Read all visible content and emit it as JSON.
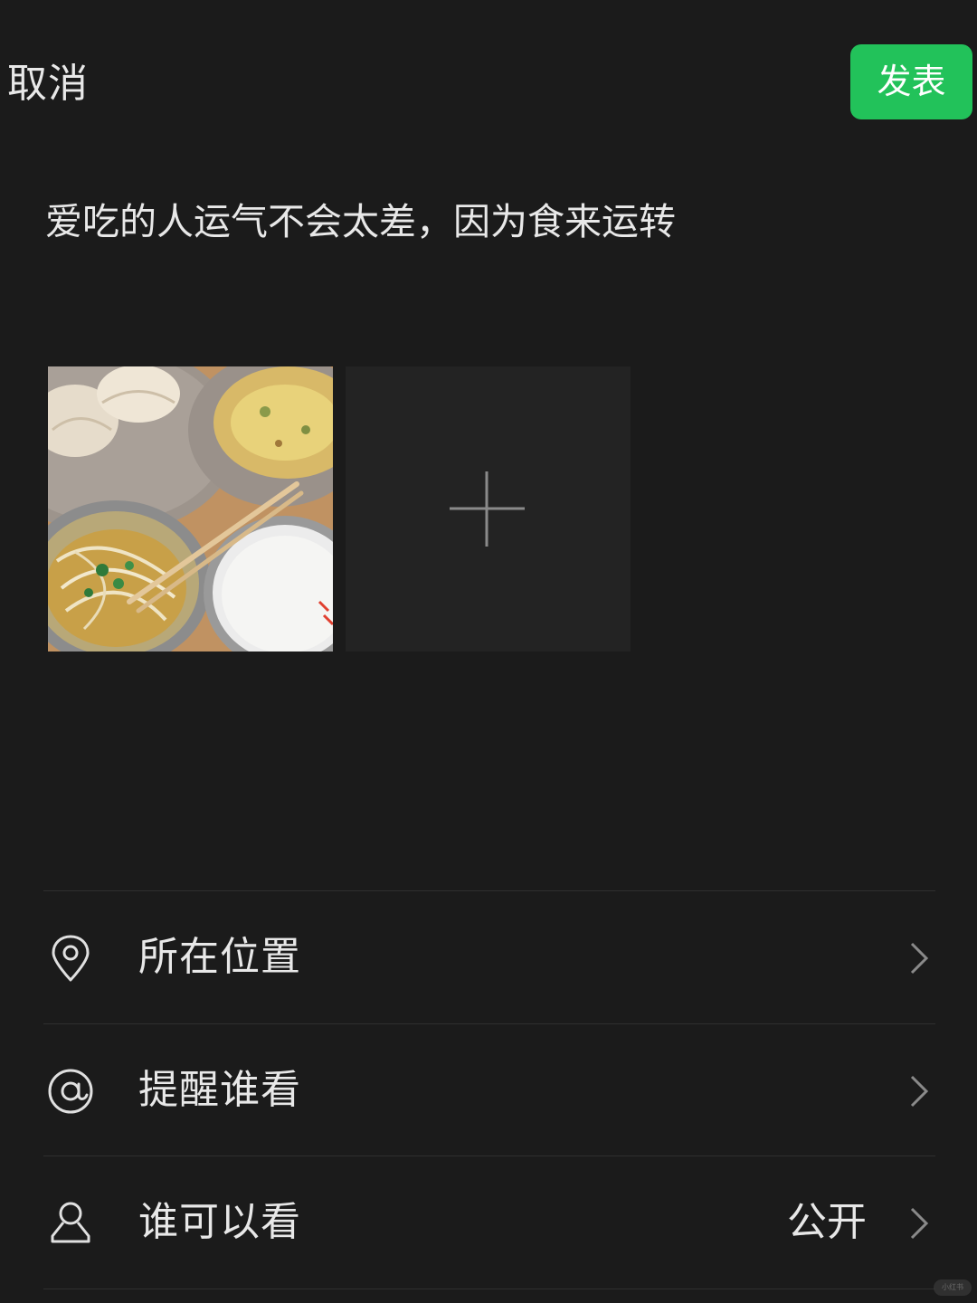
{
  "header": {
    "cancel_label": "取消",
    "publish_label": "发表",
    "publish_color": "#22c25a"
  },
  "post": {
    "caption": "爱吃的人运气不会太差，因为食来运转",
    "photos": [
      {
        "icon": "food-photo-thumbnail"
      }
    ],
    "add_tile_icon": "plus-icon"
  },
  "options": [
    {
      "icon": "location-pin-icon",
      "label": "所在位置",
      "value": ""
    },
    {
      "icon": "at-sign-icon",
      "label": "提醒谁看",
      "value": ""
    },
    {
      "icon": "person-icon",
      "label": "谁可以看",
      "value": "公开"
    }
  ],
  "watermark": "小红书",
  "colors": {
    "background": "#1b1b1b",
    "divider": "#2f2f2f",
    "text": "#e8e8e8"
  }
}
